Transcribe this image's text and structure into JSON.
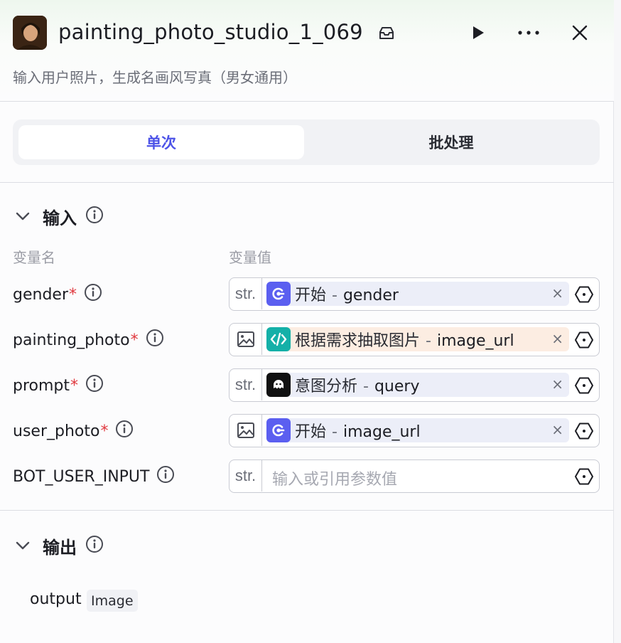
{
  "header": {
    "title": "painting_photo_studio_1_069",
    "subtitle": "输入用户照片，生成名画风写真（男女通用）",
    "icons": [
      "avatar-painting",
      "inbox-icon",
      "play-icon",
      "more-icon",
      "close-icon"
    ]
  },
  "tabs": [
    {
      "label": "单次",
      "active": true
    },
    {
      "label": "批处理",
      "active": false
    }
  ],
  "input_section": {
    "title": "输入",
    "col_name": "变量名",
    "col_value": "变量值",
    "rows": [
      {
        "name": "gender",
        "required": "*",
        "type": "str.",
        "node": "开始",
        "sep": "-",
        "param": "gender",
        "remove": "×"
      },
      {
        "name": "painting_photo",
        "required": "*",
        "type": "image",
        "node": "根据需求抽取图片",
        "sep": "-",
        "param": "image_url",
        "remove": "×"
      },
      {
        "name": "prompt",
        "required": "*",
        "type": "str.",
        "node": "意图分析",
        "sep": "-",
        "param": "query",
        "remove": "×"
      },
      {
        "name": "user_photo",
        "required": "*",
        "type": "image",
        "node": "开始",
        "sep": "-",
        "param": "image_url",
        "remove": "×"
      },
      {
        "name": "BOT_USER_INPUT",
        "type": "str.",
        "placeholder": "输入或引用参数值"
      }
    ]
  },
  "output_section": {
    "title": "输出",
    "name": "output",
    "type": "Image"
  },
  "colors": {
    "accent": "#4d53e8",
    "start_node": "#5b5ff0",
    "code_node": "#14b0a8",
    "intent_node": "#111111",
    "required": "#e0383e"
  }
}
